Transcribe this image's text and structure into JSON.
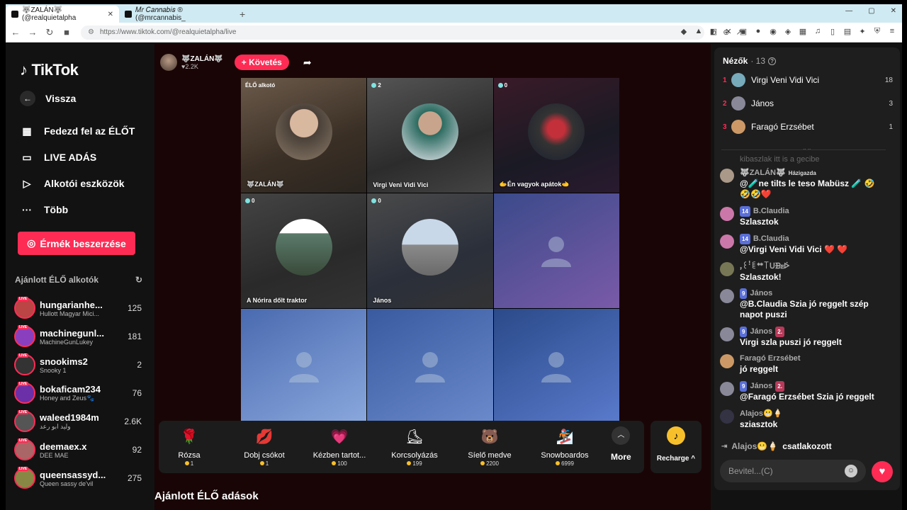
{
  "browser": {
    "tabs": [
      {
        "title": "🐺ZALÁN🐺 (@realquietalpha"
      },
      {
        "title": "𝑀𝑟 𝐶𝑎𝑛𝑛𝑎𝑏𝑖𝑠 ® (@mrcannabis_"
      }
    ],
    "url": "https://www.tiktok.com/@realquietalpha/live"
  },
  "sidebar": {
    "logo": "TikTok",
    "nav": [
      {
        "label": "Vissza",
        "icon": "arrow-left-icon"
      },
      {
        "label": "Fedezd fel az ÉLŐT",
        "icon": "calendar-icon"
      },
      {
        "label": "LIVE ADÁS",
        "icon": "video-camera-icon"
      },
      {
        "label": "Alkotói eszközök",
        "icon": "play-icon"
      },
      {
        "label": "Több",
        "icon": "more-icon"
      }
    ],
    "coins_button": "Érmék beszerzése",
    "recommended_title": "Ajánlott ÉLŐ alkotók",
    "creators": [
      {
        "name": "hungarianhe...",
        "sub": "Hullott Magyar Mici...",
        "count": "125",
        "color": "#b44"
      },
      {
        "name": "machinegunl...",
        "sub": "MachineGunLukey",
        "count": "181",
        "color": "#8a3fbf"
      },
      {
        "name": "snookims2",
        "sub": "Snooky 1",
        "count": "2",
        "color": "#333"
      },
      {
        "name": "bokaficam234",
        "sub": "Honey and Zeus🐾",
        "count": "76",
        "color": "#6b2fa8"
      },
      {
        "name": "waleed1984m",
        "sub": "وليد ابو رعد",
        "count": "2.6K",
        "color": "#555"
      },
      {
        "name": "deemaex.x",
        "sub": "DEE MAE",
        "count": "92",
        "color": "#a66"
      },
      {
        "name": "queensassyd...",
        "sub": "Queen sassy de'vil",
        "count": "275",
        "color": "#884"
      }
    ]
  },
  "host": {
    "name": "🐺ZALÁN🐺",
    "likes": "♥2.2K",
    "follow_label": "+ Követés"
  },
  "grid": [
    {
      "label": "🐺ZALÁN🐺",
      "badge": "ÉLŐ alkotó",
      "bg": "linear-gradient(160deg,#6b5a4a,#3a2f25 60%,#2a2520)",
      "avatar": "radial-gradient(circle at 50% 35%,#d9b8a0 0 30%,#4a4038 31%,#8a7a68)"
    },
    {
      "label": "Virgi Veni Vidi Vici",
      "badge": "2",
      "bg": "linear-gradient(160deg,#555,#2c2c2c 60%,#444)",
      "avatar": "radial-gradient(circle at 50% 35%,#c9a48c 0 25%,#2b6b60 26%,#e8e8ef)"
    },
    {
      "label": "🫱Én vagyok apátok🫲",
      "badge": "0",
      "bg": "linear-gradient(160deg,#3a1a28,#1a1a24 60%,#2a1a30)",
      "avatar": "radial-gradient(circle at 50% 45%,#c4303a 0 20%,#333 40%,#1a2030)"
    },
    {
      "label": "A Nórira dőlt traktor",
      "badge": "0",
      "bg": "linear-gradient(160deg,#444,#2a2a2a 60%,#333)",
      "avatar": "linear-gradient(180deg,#fff 0 25%,#5a7a6a 26%,#3a4a3a)"
    },
    {
      "label": "János",
      "badge": "0",
      "bg": "linear-gradient(160deg,#4a4a4a,#2a2f3a 60%,#333)",
      "avatar": "linear-gradient(180deg,#c8d8e8 0 45%,#8a8a8a 46%,#6a6a6a)"
    }
  ],
  "gifts": [
    {
      "name": "Rózsa",
      "price": "1",
      "icon": "🌹"
    },
    {
      "name": "Dobj csókot",
      "price": "1",
      "icon": "💋"
    },
    {
      "name": "Kézben tartot...",
      "price": "100",
      "icon": "💗"
    },
    {
      "name": "Korcsolyázás",
      "price": "199",
      "icon": "⛸"
    },
    {
      "name": "Síelő medve",
      "price": "2200",
      "icon": "🐻"
    },
    {
      "name": "Snowboardos",
      "price": "6999",
      "icon": "🏂"
    }
  ],
  "more_label": "More",
  "recharge_label": "Recharge ^",
  "recommended_live": "Ajánlott ÉLŐ adások",
  "viewers": {
    "title": "Nézők",
    "count": "· 13",
    "list": [
      {
        "rank": "1",
        "name": "Virgi Veni Vidi Vici",
        "score": "18",
        "color": "#7ab"
      },
      {
        "rank": "2",
        "name": "János",
        "score": "3",
        "color": "#889"
      },
      {
        "rank": "3",
        "name": "Faragó Erzsébet",
        "score": "1",
        "color": "#c96"
      }
    ]
  },
  "chat": {
    "faded": "kibaszlak itt is a gecibe",
    "messages": [
      {
        "user": "🐺ZALÁN🐺",
        "badge": "Házigazda",
        "text": "@🧪ne tilts le teso Mabüsz 🧪 🤣",
        "text2": "🤣🤣❤️",
        "color": "#a98"
      },
      {
        "user": "B.Claudia",
        "lvl": "14",
        "text": "Szlasztok",
        "color": "#c7a"
      },
      {
        "user": "B.Claudia",
        "lvl": "14",
        "text": "@Virgi Veni Vidi Vici ❤️ ❤️",
        "color": "#c7a"
      },
      {
        "user": "ꓹ꒰ꜝ꒲ᕯ꓄ᑌᗿꭼᢰ",
        "text": "Szlasztok!",
        "color": "#775"
      },
      {
        "user": "János",
        "lvl": "9",
        "text": "@B.Claudia Szia jó reggelt szép",
        "text2": "napot puszi",
        "color": "#889"
      },
      {
        "user": "János",
        "lvl": "9",
        "lvl2": "2.",
        "text": "Virgi szla puszi jó reggelt",
        "color": "#889"
      },
      {
        "user": "Faragó Erzsébet",
        "text": "jó reggelt",
        "color": "#c96"
      },
      {
        "user": "János",
        "lvl": "9",
        "lvl2": "2.",
        "text": "@Faragó Erzsébet Szia jó reggelt",
        "color": "#889"
      },
      {
        "user": "Alajos😬🍦",
        "text": "sziasztok",
        "color": "#334"
      }
    ],
    "joined_user": "Alajos😬🍦",
    "joined_text": "csatlakozott",
    "input_placeholder": "Bevitel...(C)"
  }
}
